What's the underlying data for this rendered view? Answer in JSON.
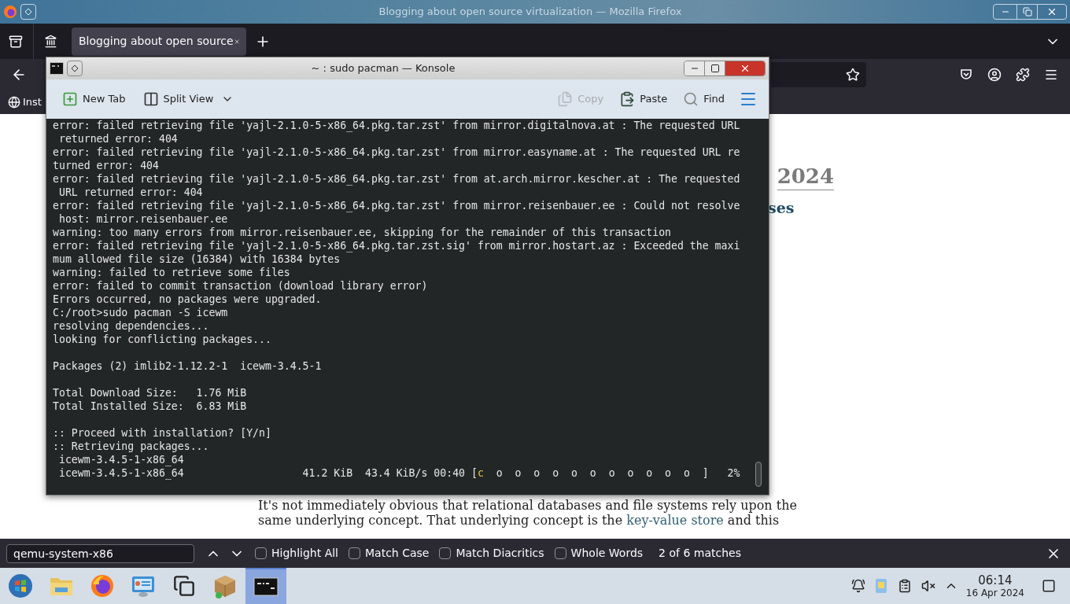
{
  "firefox": {
    "window_title": "Blogging about open source virtualization — Mozilla Firefox",
    "tabs": [
      {
        "title": "Blogging about open source",
        "selected": true
      }
    ],
    "bookmarks": [
      {
        "label": "Inst"
      }
    ],
    "page": {
      "date_heading": "2024",
      "post_title": "ses",
      "paragraph": {
        "before": "It's not immediately obvious that relational databases and file systems rely upon the same underlying concept. That underlying concept is the ",
        "link": "key-value store",
        "after": " and this"
      }
    },
    "find_bar": {
      "query": "qemu-system-x86",
      "options": [
        {
          "label": "Highlight All",
          "checked": false
        },
        {
          "label": "Match Case",
          "checked": false
        },
        {
          "label": "Match Diacritics",
          "checked": false
        },
        {
          "label": "Whole Words",
          "checked": false
        }
      ],
      "status": "2 of 6 matches"
    }
  },
  "konsole": {
    "title": "~ : sudo pacman — Konsole",
    "toolbar_left": [
      {
        "kind": "new-tab",
        "label": "New Tab",
        "disabled": false
      },
      {
        "kind": "split-view",
        "label": "Split View",
        "disabled": false
      }
    ],
    "toolbar_right": [
      {
        "kind": "copy",
        "label": "Copy",
        "disabled": true
      },
      {
        "kind": "paste",
        "label": "Paste",
        "disabled": false
      },
      {
        "kind": "find",
        "label": "Find",
        "disabled": false
      }
    ],
    "lines": [
      {
        "kind": "plain",
        "text": "error: failed retrieving file 'yajl-2.1.0-5-x86_64.pkg.tar.zst' from mirror.digitalnova.at : The requested URL"
      },
      {
        "kind": "plain",
        "text": " returned error: 404"
      },
      {
        "kind": "plain",
        "text": "error: failed retrieving file 'yajl-2.1.0-5-x86_64.pkg.tar.zst' from mirror.easyname.at : The requested URL re"
      },
      {
        "kind": "plain",
        "text": "turned error: 404"
      },
      {
        "kind": "plain",
        "text": "error: failed retrieving file 'yajl-2.1.0-5-x86_64.pkg.tar.zst' from at.arch.mirror.kescher.at : The requested"
      },
      {
        "kind": "plain",
        "text": " URL returned error: 404"
      },
      {
        "kind": "plain",
        "text": "error: failed retrieving file 'yajl-2.1.0-5-x86_64.pkg.tar.zst' from mirror.reisenbauer.ee : Could not resolve"
      },
      {
        "kind": "plain",
        "text": " host: mirror.reisenbauer.ee"
      },
      {
        "kind": "plain",
        "text": "warning: too many errors from mirror.reisenbauer.ee, skipping for the remainder of this transaction"
      },
      {
        "kind": "plain",
        "text": "error: failed retrieving file 'yajl-2.1.0-5-x86_64.pkg.tar.zst.sig' from mirror.hostart.az : Exceeded the maxi"
      },
      {
        "kind": "plain",
        "text": "mum allowed file size (16384) with 16384 bytes"
      },
      {
        "kind": "plain",
        "text": "warning: failed to retrieve some files"
      },
      {
        "kind": "plain",
        "text": "error: failed to commit transaction (download library error)"
      },
      {
        "kind": "plain",
        "text": "Errors occurred, no packages were upgraded."
      },
      {
        "kind": "plain",
        "text": "C:/root>sudo pacman -S icewm"
      },
      {
        "kind": "plain",
        "text": "resolving dependencies..."
      },
      {
        "kind": "plain",
        "text": "looking for conflicting packages..."
      },
      {
        "kind": "blank"
      },
      {
        "kind": "plain",
        "text": "Packages (2) imlib2-1.12.2-1  icewm-3.4.5-1"
      },
      {
        "kind": "blank"
      },
      {
        "kind": "plain",
        "text": "Total Download Size:   1.76 MiB"
      },
      {
        "kind": "plain",
        "text": "Total Installed Size:  6.83 MiB"
      },
      {
        "kind": "blank"
      },
      {
        "kind": "plain",
        "text": ":: Proceed with installation? [Y/n]"
      },
      {
        "kind": "plain",
        "text": ":: Retrieving packages..."
      },
      {
        "kind": "plain",
        "text": " icewm-3.4.5-1-x86_64"
      },
      {
        "kind": "colored",
        "segments": [
          {
            "text": " icewm-3.4.5-1-x86_64                   41.2 KiB  43.4 KiB/s 00:40 [",
            "color": "#e6e6e6"
          },
          {
            "text": "c",
            "color": "#e2c441"
          },
          {
            "text": "  o  o  o  o  o  o  o  o  o  o  o  ]   2%",
            "color": "#e6e6e6"
          }
        ]
      }
    ]
  },
  "taskbar": {
    "apps": [
      {
        "kind": "start",
        "active": false
      },
      {
        "kind": "files",
        "active": false
      },
      {
        "kind": "firefox",
        "active": false
      },
      {
        "kind": "control-panel",
        "active": false
      },
      {
        "kind": "windows",
        "active": false
      },
      {
        "kind": "package",
        "active": false
      },
      {
        "kind": "terminal",
        "active": true
      }
    ],
    "time": "06:14",
    "date": "16 Apr 2024"
  }
}
